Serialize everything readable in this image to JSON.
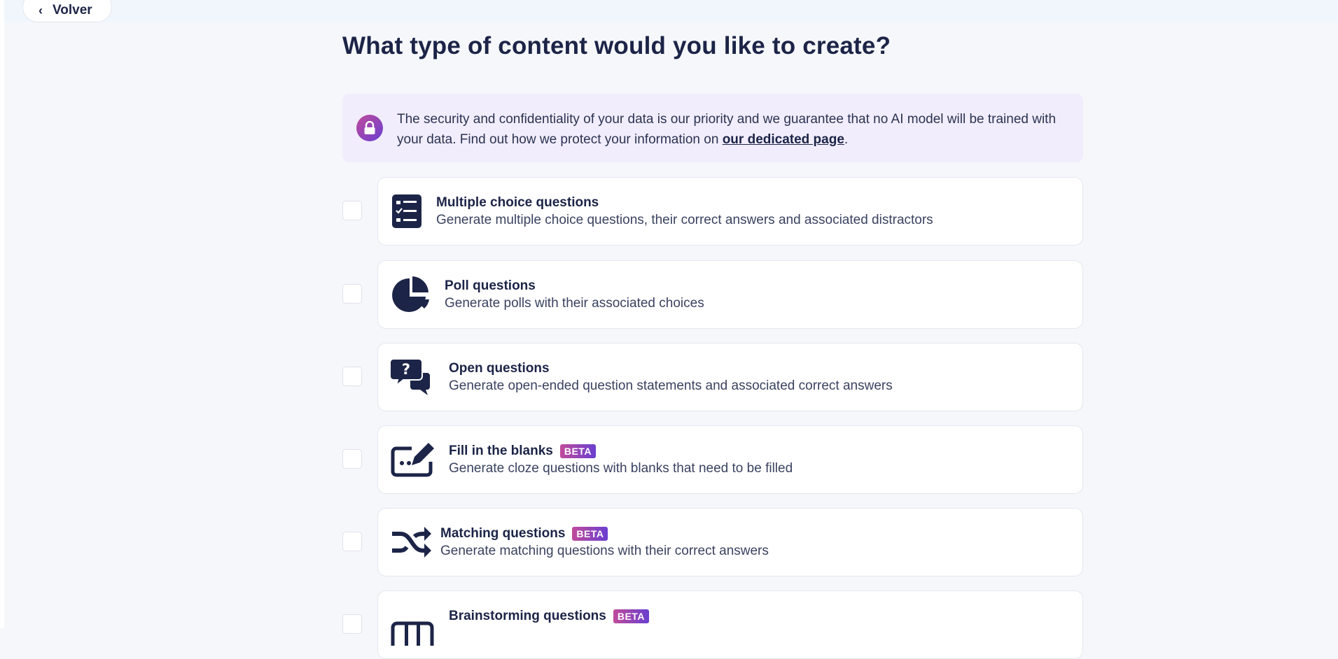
{
  "nav": {
    "back_label": "Volver"
  },
  "page": {
    "title": "What type of content would you like to create?"
  },
  "notice": {
    "text_before": "The security and confidentiality of your data is our priority and we guarantee that no AI model will be trained with your data. Find out how we protect your information on ",
    "link_text": "our dedicated page",
    "text_after": "."
  },
  "options": [
    {
      "name": "Multiple choice questions",
      "desc": "Generate multiple choice questions, their correct answers and associated distractors",
      "badge": "",
      "icon": "checklist-icon"
    },
    {
      "name": "Poll questions",
      "desc": "Generate polls with their associated choices",
      "badge": "",
      "icon": "pie-chart-icon"
    },
    {
      "name": "Open questions",
      "desc": "Generate open-ended question statements and associated correct answers",
      "badge": "",
      "icon": "question-bubbles-icon"
    },
    {
      "name": "Fill in the blanks",
      "desc": "Generate cloze questions with blanks that need to be filled",
      "badge": "BETA",
      "icon": "fill-blank-pencil-icon"
    },
    {
      "name": "Matching questions",
      "desc": "Generate matching questions with their correct answers",
      "badge": "BETA",
      "icon": "shuffle-arrows-icon"
    },
    {
      "name": "Brainstorming questions",
      "desc": "",
      "badge": "BETA",
      "icon": "board-columns-icon"
    }
  ],
  "colors": {
    "accent_start": "#c04b9b",
    "accent_end": "#6a3fd0",
    "text_dark": "#1c2447",
    "notice_bg": "#f1edfc"
  }
}
